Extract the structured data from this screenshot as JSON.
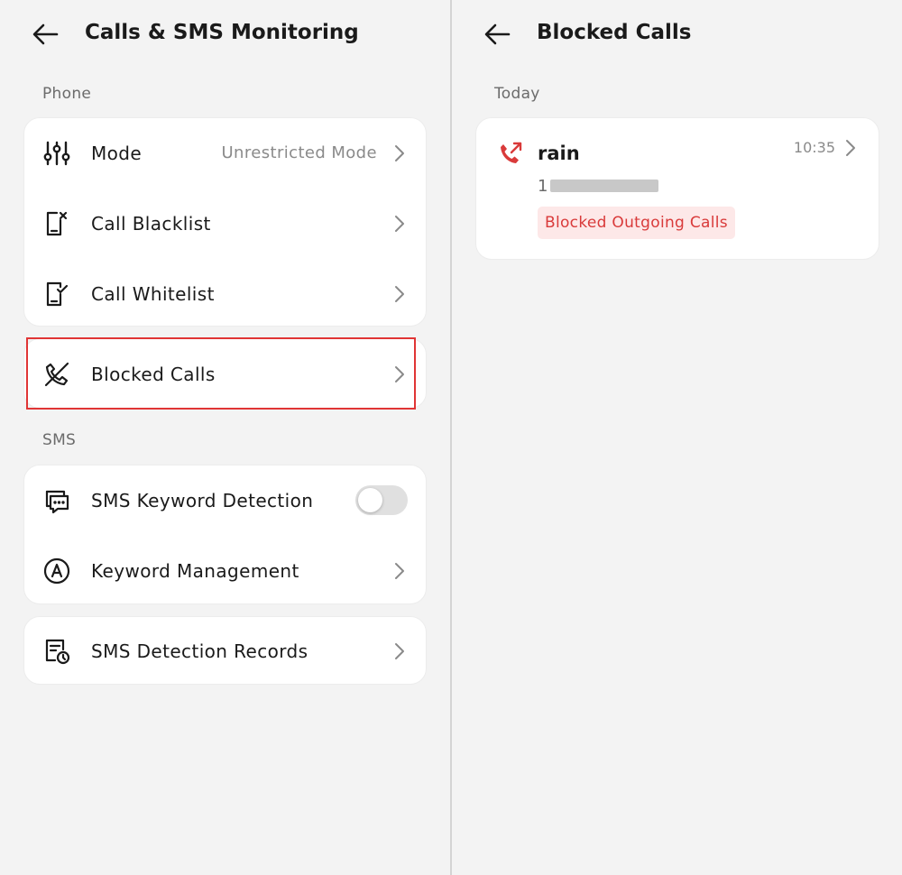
{
  "left_pane": {
    "title": "Calls & SMS Monitoring",
    "phone_section_label": "Phone",
    "sms_section_label": "SMS",
    "phone_items": [
      {
        "label": "Mode",
        "value": "Unrestricted Mode",
        "icon": "sliders-icon"
      },
      {
        "label": "Call Blacklist",
        "icon": "blacklist-phone-icon"
      },
      {
        "label": "Call Whitelist",
        "icon": "whitelist-phone-icon"
      }
    ],
    "blocked_calls": {
      "label": "Blocked Calls",
      "icon": "phone-blocked-icon"
    },
    "sms_items": [
      {
        "label": "SMS Keyword Detection",
        "icon": "message-icon",
        "toggle_on": false
      },
      {
        "label": "Keyword Management",
        "icon": "keyword-a-icon"
      }
    ],
    "sms_records": {
      "label": "SMS Detection Records",
      "icon": "records-clock-icon"
    }
  },
  "right_pane": {
    "title": "Blocked Calls",
    "date_group": "Today",
    "calls": [
      {
        "name": "rain",
        "number_prefix": "1",
        "time": "10:35",
        "tag": "Blocked Outgoing Calls",
        "icon": "outgoing-call-icon"
      }
    ]
  },
  "colors": {
    "background": "#f3f3f3",
    "card": "#ffffff",
    "accent_red": "#d93a3a",
    "tag_bg": "#fde8e8",
    "highlight": "#e03535"
  }
}
